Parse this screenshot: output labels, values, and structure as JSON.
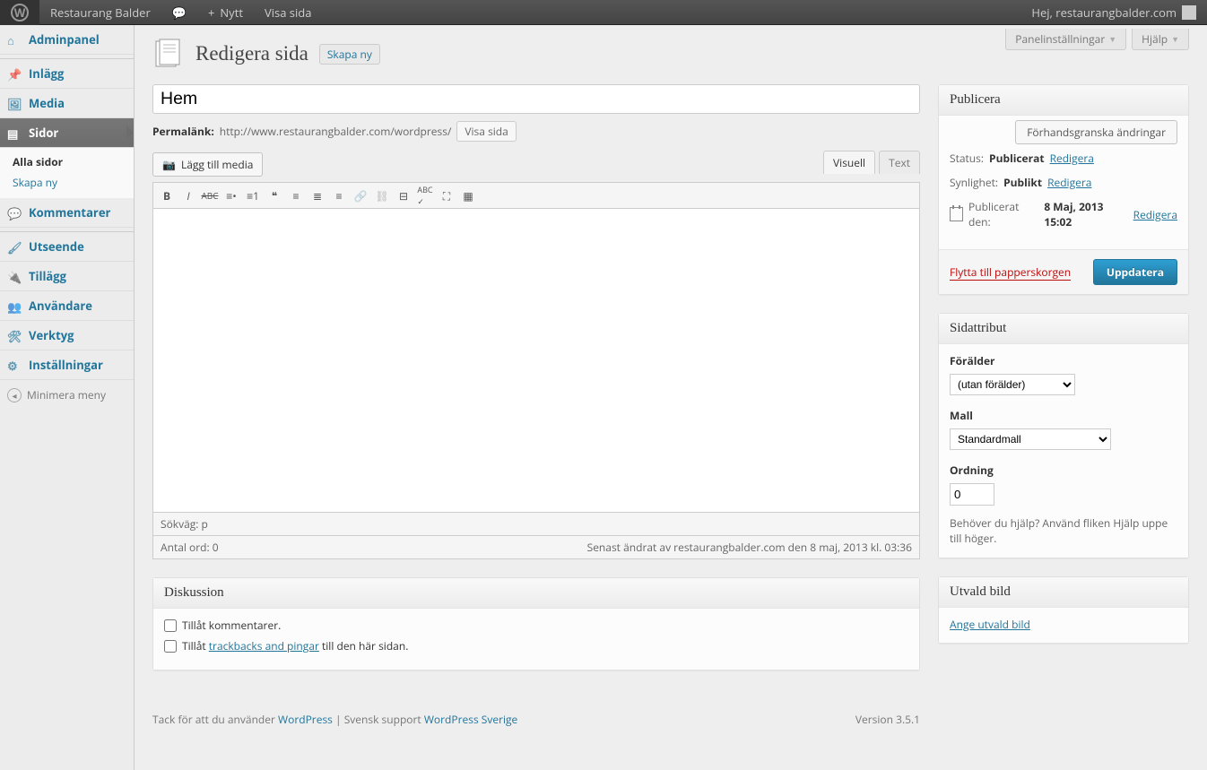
{
  "adminbar": {
    "site_name": "Restaurang Balder",
    "new_label": "Nytt",
    "view_page": "Visa sida",
    "greeting": "Hej, restaurangbalder.com"
  },
  "screen_meta": {
    "panel": "Panelinställningar",
    "help": "Hjälp"
  },
  "menu": {
    "dashboard": "Adminpanel",
    "posts": "Inlägg",
    "media": "Media",
    "pages": "Sidor",
    "pages_all": "Alla sidor",
    "pages_new": "Skapa ny",
    "comments": "Kommentarer",
    "appearance": "Utseende",
    "plugins": "Tillägg",
    "users": "Användare",
    "tools": "Verktyg",
    "settings": "Inställningar",
    "collapse": "Minimera meny"
  },
  "page": {
    "title": "Redigera sida",
    "add_new": "Skapa ny",
    "post_title": "Hem",
    "permalink_label": "Permalänk:",
    "permalink_url": "http://www.restaurangbalder.com/wordpress/",
    "view_btn": "Visa sida",
    "add_media": "Lägg till media",
    "tab_visual": "Visuell",
    "tab_text": "Text",
    "path_label": "Sökväg: p",
    "word_count": "Antal ord: 0",
    "last_edit": "Senast ändrat av restaurangbalder.com den 8 maj, 2013 kl. 03:36"
  },
  "publish": {
    "heading": "Publicera",
    "preview": "Förhandsgranska ändringar",
    "status_label": "Status:",
    "status_value": "Publicerat",
    "visibility_label": "Synlighet:",
    "visibility_value": "Publikt",
    "published_label": "Publicerat den:",
    "published_value": "8 Maj, 2013 15:02",
    "edit": "Redigera",
    "trash": "Flytta till papperskorgen",
    "update": "Uppdatera"
  },
  "attributes": {
    "heading": "Sidattribut",
    "parent_label": "Förälder",
    "parent_value": "(utan förälder)",
    "template_label": "Mall",
    "template_value": "Standardmall",
    "order_label": "Ordning",
    "order_value": "0",
    "help": "Behöver du hjälp? Använd fliken Hjälp uppe till höger."
  },
  "featured": {
    "heading": "Utvald bild",
    "set": "Ange utvald bild"
  },
  "discussion": {
    "heading": "Diskussion",
    "allow_comments": "Tillåt kommentarer.",
    "allow_prefix": "Tillåt ",
    "trackbacks_link": "trackbacks and pingar",
    "allow_suffix": " till den här sidan."
  },
  "footer": {
    "thanks_prefix": "Tack för att du använder ",
    "wp": "WordPress",
    "sep": " | Svensk support ",
    "wps": "WordPress Sverige",
    "version": "Version 3.5.1"
  }
}
